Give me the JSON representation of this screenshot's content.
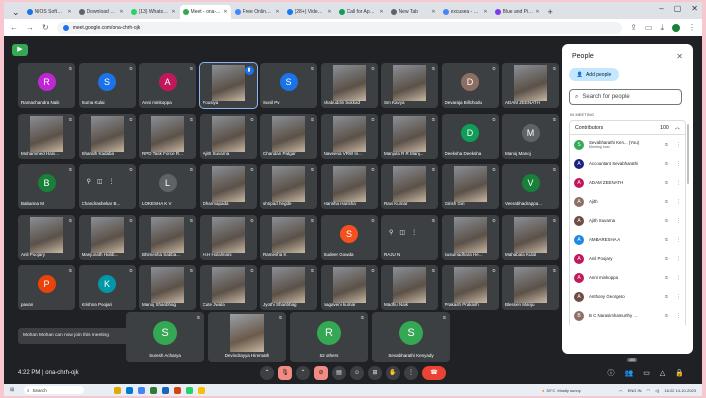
{
  "browser": {
    "tabs": [
      {
        "label": "NIOS Software Pr...",
        "color": "#1a73e8"
      },
      {
        "label": "Download History",
        "color": "#5f6368"
      },
      {
        "label": "(13) WhatsApp",
        "color": "#25d366"
      },
      {
        "label": "Meet - ona-...",
        "color": "#34a853",
        "active": true
      },
      {
        "label": "Free Online MHD",
        "color": "#4285f4"
      },
      {
        "label": "(28+) Video | Fac...",
        "color": "#1877f2"
      },
      {
        "label": "Call for Applicati...",
        "color": "#0f9d58"
      },
      {
        "label": "New Tab",
        "color": "#5f6368"
      },
      {
        "label": "excusea - Googl...",
        "color": "#4285f4"
      },
      {
        "label": "Blue and Pink M...",
        "color": "#7c3aed"
      }
    ],
    "new_tab": "+",
    "url": "meet.google.com/ona-chrh-ojk"
  },
  "tiles": [
    {
      "name": "Ramachandra Naik",
      "initial": "R",
      "color": "#c026d3"
    },
    {
      "name": "Suma Kulai",
      "initial": "S",
      "color": "#1a73e8"
    },
    {
      "name": "Anni minkoppa",
      "initial": "A",
      "color": "#c2185b"
    },
    {
      "name": "Fousiya",
      "photo": true,
      "outlined": true,
      "speaking": true
    },
    {
      "name": "Sunil Pv",
      "initial": "S",
      "color": "#1a73e8"
    },
    {
      "name": "shabuddin bukkad",
      "photo": true
    },
    {
      "name": "Sm Kavya",
      "photo": true
    },
    {
      "name": "Devaraja Billchodu",
      "initial": "D",
      "color": "#8d6e63"
    },
    {
      "name": "ADAM ZEENATH",
      "photo": true
    },
    {
      "name": "Mohammed Hani...",
      "photo": true
    },
    {
      "name": "Sharath Kadaba",
      "photo": true
    },
    {
      "name": "RPD Task Force R...",
      "photo": true
    },
    {
      "name": "Ajith Suvarna",
      "photo": true
    },
    {
      "name": "Chandan Patgar",
      "photo": true
    },
    {
      "name": "Naveena VRW In...",
      "photo": true
    },
    {
      "name": "Manjula R R Manj...",
      "photo": true
    },
    {
      "name": "Deeksha Deeksha",
      "initial": "D",
      "color": "#0f9d58"
    },
    {
      "name": "Manoj Manoj",
      "initial": "M",
      "color": "#5f6368"
    },
    {
      "name": "Babanna M",
      "initial": "B",
      "color": "#188038"
    },
    {
      "name": "Chandrashekar B...",
      "controls": true
    },
    {
      "name": "LOKESHA K V",
      "initial": "L",
      "color": "#5f6368"
    },
    {
      "name": "Dharmapada",
      "photo": true
    },
    {
      "name": "shripad hegde",
      "photo": true
    },
    {
      "name": "Harisha Harisha",
      "photo": true
    },
    {
      "name": "Ravi Kumar",
      "photo": true
    },
    {
      "name": "Girish Giri",
      "photo": true
    },
    {
      "name": "Veerabhadrappa...",
      "initial": "V",
      "color": "#188038"
    },
    {
      "name": "Anil Poojary",
      "photo": true
    },
    {
      "name": "Manjunath Hubb...",
      "photo": true
    },
    {
      "name": "Bhimesha Sabba...",
      "photo": true
    },
    {
      "name": "H.H Holalmani",
      "photo": true
    },
    {
      "name": "Ramesha K",
      "photo": true
    },
    {
      "name": "Sudeer Gowda",
      "initial": "S",
      "color": "#f4511e"
    },
    {
      "name": "RAJU N",
      "controls": true
    },
    {
      "name": "kusumadhara He...",
      "photo": true
    },
    {
      "name": "Mahabala Kulal",
      "photo": true
    },
    {
      "name": "pavan",
      "initial": "P",
      "color": "#e8430a"
    },
    {
      "name": "Krishna Poojari",
      "initial": "K",
      "color": "#0097a7"
    },
    {
      "name": "Manoj Shanbhag",
      "photo": true
    },
    {
      "name": "Cute Jwala",
      "photo": true
    },
    {
      "name": "Jyothi Shanbhag",
      "photo": true
    },
    {
      "name": "nagaveni kumar",
      "photo": true
    },
    {
      "name": "Madhu Naik",
      "photo": true
    },
    {
      "name": "Prakash Prakash",
      "photo": true
    },
    {
      "name": "Blessen Manju",
      "photo": true
    }
  ],
  "bottom_tiles": [
    {
      "name": "Suresh Acharya",
      "initial": "S",
      "color": "#34a853"
    },
    {
      "name": "Devindrayya Hiremath",
      "photo": true
    },
    {
      "name": "52 others",
      "initial": "R",
      "color": "#34a853"
    },
    {
      "name": "Sevabharathi Kenyady",
      "initial": "S",
      "color": "#34a853"
    }
  ],
  "toast": "Mohan Mohan can now join this meeting",
  "people_panel": {
    "title": "People",
    "add_people": "Add people",
    "search_placeholder": "Search for people",
    "section": "IN MEETING",
    "group_label": "Contributors",
    "group_count": "100",
    "participants": [
      {
        "name": "Sevabharathi Ken... (You)",
        "sub": "Meeting host",
        "initial": "S",
        "color": "#34a853"
      },
      {
        "name": "Accountant Sevabharathi",
        "initial": "A",
        "color": "#1a237e"
      },
      {
        "name": "ADAM ZEENATH",
        "initial": "A",
        "color": "#c2185b"
      },
      {
        "name": "Ajith",
        "initial": "A",
        "color": "#8d6e63"
      },
      {
        "name": "Ajith Suvarna",
        "initial": "A",
        "color": "#6d4c41"
      },
      {
        "name": "AMBARESHA A",
        "initial": "A",
        "color": "#1e88e5"
      },
      {
        "name": "Anil Poojary",
        "initial": "A",
        "color": "#c2185b"
      },
      {
        "name": "Anni minkoppa",
        "initial": "A",
        "color": "#c2185b"
      },
      {
        "name": "Anthony Georgeto",
        "initial": "A",
        "color": "#6d4c41"
      },
      {
        "name": "B C Narasimhamurthy ...",
        "initial": "B",
        "color": "#8d6e63"
      }
    ]
  },
  "meetbar": {
    "time": "4:22 PM",
    "sep": "|",
    "code": "ona-chrh-ojk",
    "participant_badge": "100"
  },
  "taskbar": {
    "search": "Search",
    "weather_temp": "30°C",
    "weather_desc": "Mostly sunny",
    "lang": "ENG IN",
    "clock": "16:22",
    "date": "14-10-2023"
  }
}
